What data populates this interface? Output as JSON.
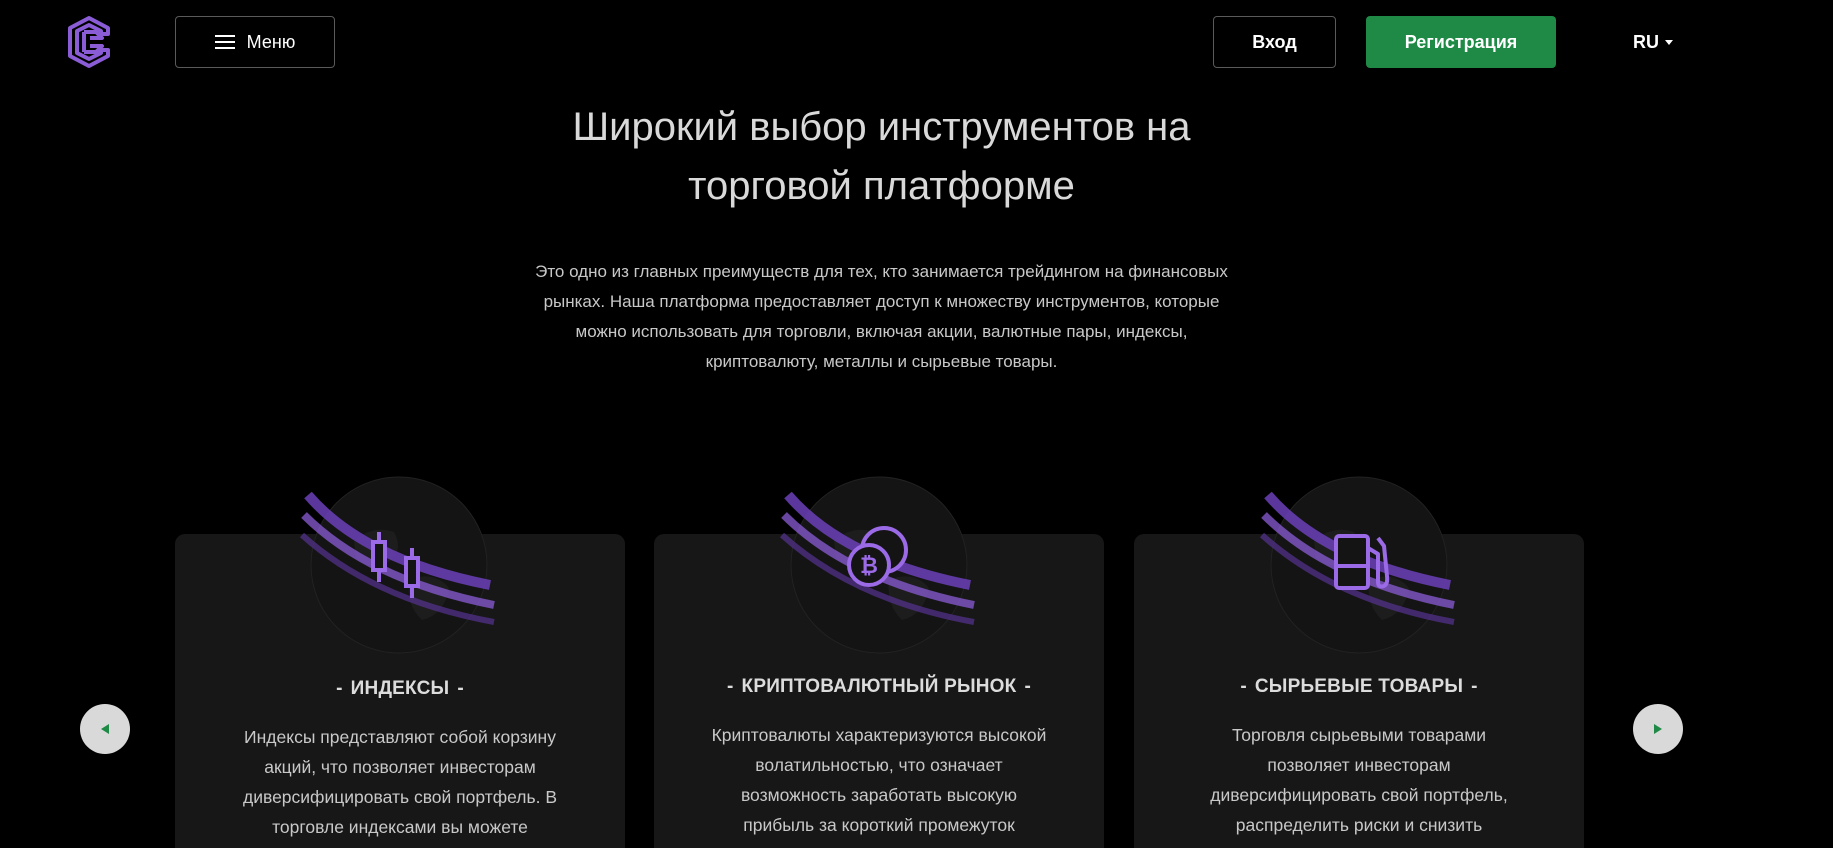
{
  "header": {
    "menu_label": "Меню",
    "login_label": "Вход",
    "register_label": "Регистрация",
    "language": "RU"
  },
  "hero": {
    "title": "Широкий выбор инструментов на торговой платформе",
    "description": "Это одно из главных преимуществ для тех, кто занимается трейдингом на финансовых рынках. Наша платформа предоставляет доступ к множеству инструментов, которые можно использовать для торговли, включая акции, валютные пары, индексы, криптовалюту, металлы и сырьевые товары."
  },
  "cards": [
    {
      "title": "ИНДЕКСЫ",
      "icon": "candlestick-icon",
      "text": "Индексы представляют собой корзину акций, что позволяет инвесторам диверсифицировать свой портфель. В торговле индексами вы можете"
    },
    {
      "title": "КРИПТОВАЛЮТНЫЙ РЫНОК",
      "icon": "bitcoin-icon",
      "text": "Криптовалюты характеризуются высокой волатильностью, что означает возможность заработать высокую прибыль за короткий промежуток времени."
    },
    {
      "title": "СЫРЬЕВЫЕ ТОВАРЫ",
      "icon": "fuel-pump-icon",
      "text": "Торговля сырьевыми товарами позволяет инвесторам диверсифицировать свой портфель, распределить риски и снизить зависимость от конкретных активов."
    }
  ],
  "colors": {
    "background": "#000000",
    "accent_green": "#1e8a45",
    "accent_purple": "#8a5cd6",
    "card_background": "#171717"
  }
}
